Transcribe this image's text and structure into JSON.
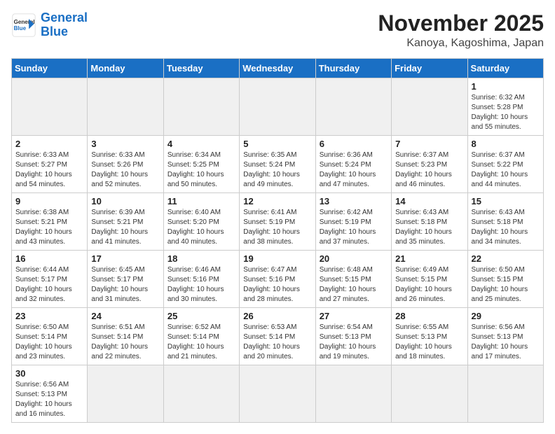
{
  "logo": {
    "text_general": "General",
    "text_blue": "Blue"
  },
  "title": "November 2025",
  "location": "Kanoya, Kagoshima, Japan",
  "weekdays": [
    "Sunday",
    "Monday",
    "Tuesday",
    "Wednesday",
    "Thursday",
    "Friday",
    "Saturday"
  ],
  "weeks": [
    [
      {
        "day": "",
        "info": ""
      },
      {
        "day": "",
        "info": ""
      },
      {
        "day": "",
        "info": ""
      },
      {
        "day": "",
        "info": ""
      },
      {
        "day": "",
        "info": ""
      },
      {
        "day": "",
        "info": ""
      },
      {
        "day": "1",
        "info": "Sunrise: 6:32 AM\nSunset: 5:28 PM\nDaylight: 10 hours and 55 minutes."
      }
    ],
    [
      {
        "day": "2",
        "info": "Sunrise: 6:33 AM\nSunset: 5:27 PM\nDaylight: 10 hours and 54 minutes."
      },
      {
        "day": "3",
        "info": "Sunrise: 6:33 AM\nSunset: 5:26 PM\nDaylight: 10 hours and 52 minutes."
      },
      {
        "day": "4",
        "info": "Sunrise: 6:34 AM\nSunset: 5:25 PM\nDaylight: 10 hours and 50 minutes."
      },
      {
        "day": "5",
        "info": "Sunrise: 6:35 AM\nSunset: 5:24 PM\nDaylight: 10 hours and 49 minutes."
      },
      {
        "day": "6",
        "info": "Sunrise: 6:36 AM\nSunset: 5:24 PM\nDaylight: 10 hours and 47 minutes."
      },
      {
        "day": "7",
        "info": "Sunrise: 6:37 AM\nSunset: 5:23 PM\nDaylight: 10 hours and 46 minutes."
      },
      {
        "day": "8",
        "info": "Sunrise: 6:37 AM\nSunset: 5:22 PM\nDaylight: 10 hours and 44 minutes."
      }
    ],
    [
      {
        "day": "9",
        "info": "Sunrise: 6:38 AM\nSunset: 5:21 PM\nDaylight: 10 hours and 43 minutes."
      },
      {
        "day": "10",
        "info": "Sunrise: 6:39 AM\nSunset: 5:21 PM\nDaylight: 10 hours and 41 minutes."
      },
      {
        "day": "11",
        "info": "Sunrise: 6:40 AM\nSunset: 5:20 PM\nDaylight: 10 hours and 40 minutes."
      },
      {
        "day": "12",
        "info": "Sunrise: 6:41 AM\nSunset: 5:19 PM\nDaylight: 10 hours and 38 minutes."
      },
      {
        "day": "13",
        "info": "Sunrise: 6:42 AM\nSunset: 5:19 PM\nDaylight: 10 hours and 37 minutes."
      },
      {
        "day": "14",
        "info": "Sunrise: 6:43 AM\nSunset: 5:18 PM\nDaylight: 10 hours and 35 minutes."
      },
      {
        "day": "15",
        "info": "Sunrise: 6:43 AM\nSunset: 5:18 PM\nDaylight: 10 hours and 34 minutes."
      }
    ],
    [
      {
        "day": "16",
        "info": "Sunrise: 6:44 AM\nSunset: 5:17 PM\nDaylight: 10 hours and 32 minutes."
      },
      {
        "day": "17",
        "info": "Sunrise: 6:45 AM\nSunset: 5:17 PM\nDaylight: 10 hours and 31 minutes."
      },
      {
        "day": "18",
        "info": "Sunrise: 6:46 AM\nSunset: 5:16 PM\nDaylight: 10 hours and 30 minutes."
      },
      {
        "day": "19",
        "info": "Sunrise: 6:47 AM\nSunset: 5:16 PM\nDaylight: 10 hours and 28 minutes."
      },
      {
        "day": "20",
        "info": "Sunrise: 6:48 AM\nSunset: 5:15 PM\nDaylight: 10 hours and 27 minutes."
      },
      {
        "day": "21",
        "info": "Sunrise: 6:49 AM\nSunset: 5:15 PM\nDaylight: 10 hours and 26 minutes."
      },
      {
        "day": "22",
        "info": "Sunrise: 6:50 AM\nSunset: 5:15 PM\nDaylight: 10 hours and 25 minutes."
      }
    ],
    [
      {
        "day": "23",
        "info": "Sunrise: 6:50 AM\nSunset: 5:14 PM\nDaylight: 10 hours and 23 minutes."
      },
      {
        "day": "24",
        "info": "Sunrise: 6:51 AM\nSunset: 5:14 PM\nDaylight: 10 hours and 22 minutes."
      },
      {
        "day": "25",
        "info": "Sunrise: 6:52 AM\nSunset: 5:14 PM\nDaylight: 10 hours and 21 minutes."
      },
      {
        "day": "26",
        "info": "Sunrise: 6:53 AM\nSunset: 5:14 PM\nDaylight: 10 hours and 20 minutes."
      },
      {
        "day": "27",
        "info": "Sunrise: 6:54 AM\nSunset: 5:13 PM\nDaylight: 10 hours and 19 minutes."
      },
      {
        "day": "28",
        "info": "Sunrise: 6:55 AM\nSunset: 5:13 PM\nDaylight: 10 hours and 18 minutes."
      },
      {
        "day": "29",
        "info": "Sunrise: 6:56 AM\nSunset: 5:13 PM\nDaylight: 10 hours and 17 minutes."
      }
    ],
    [
      {
        "day": "30",
        "info": "Sunrise: 6:56 AM\nSunset: 5:13 PM\nDaylight: 10 hours and 16 minutes."
      },
      {
        "day": "",
        "info": ""
      },
      {
        "day": "",
        "info": ""
      },
      {
        "day": "",
        "info": ""
      },
      {
        "day": "",
        "info": ""
      },
      {
        "day": "",
        "info": ""
      },
      {
        "day": "",
        "info": ""
      }
    ]
  ]
}
